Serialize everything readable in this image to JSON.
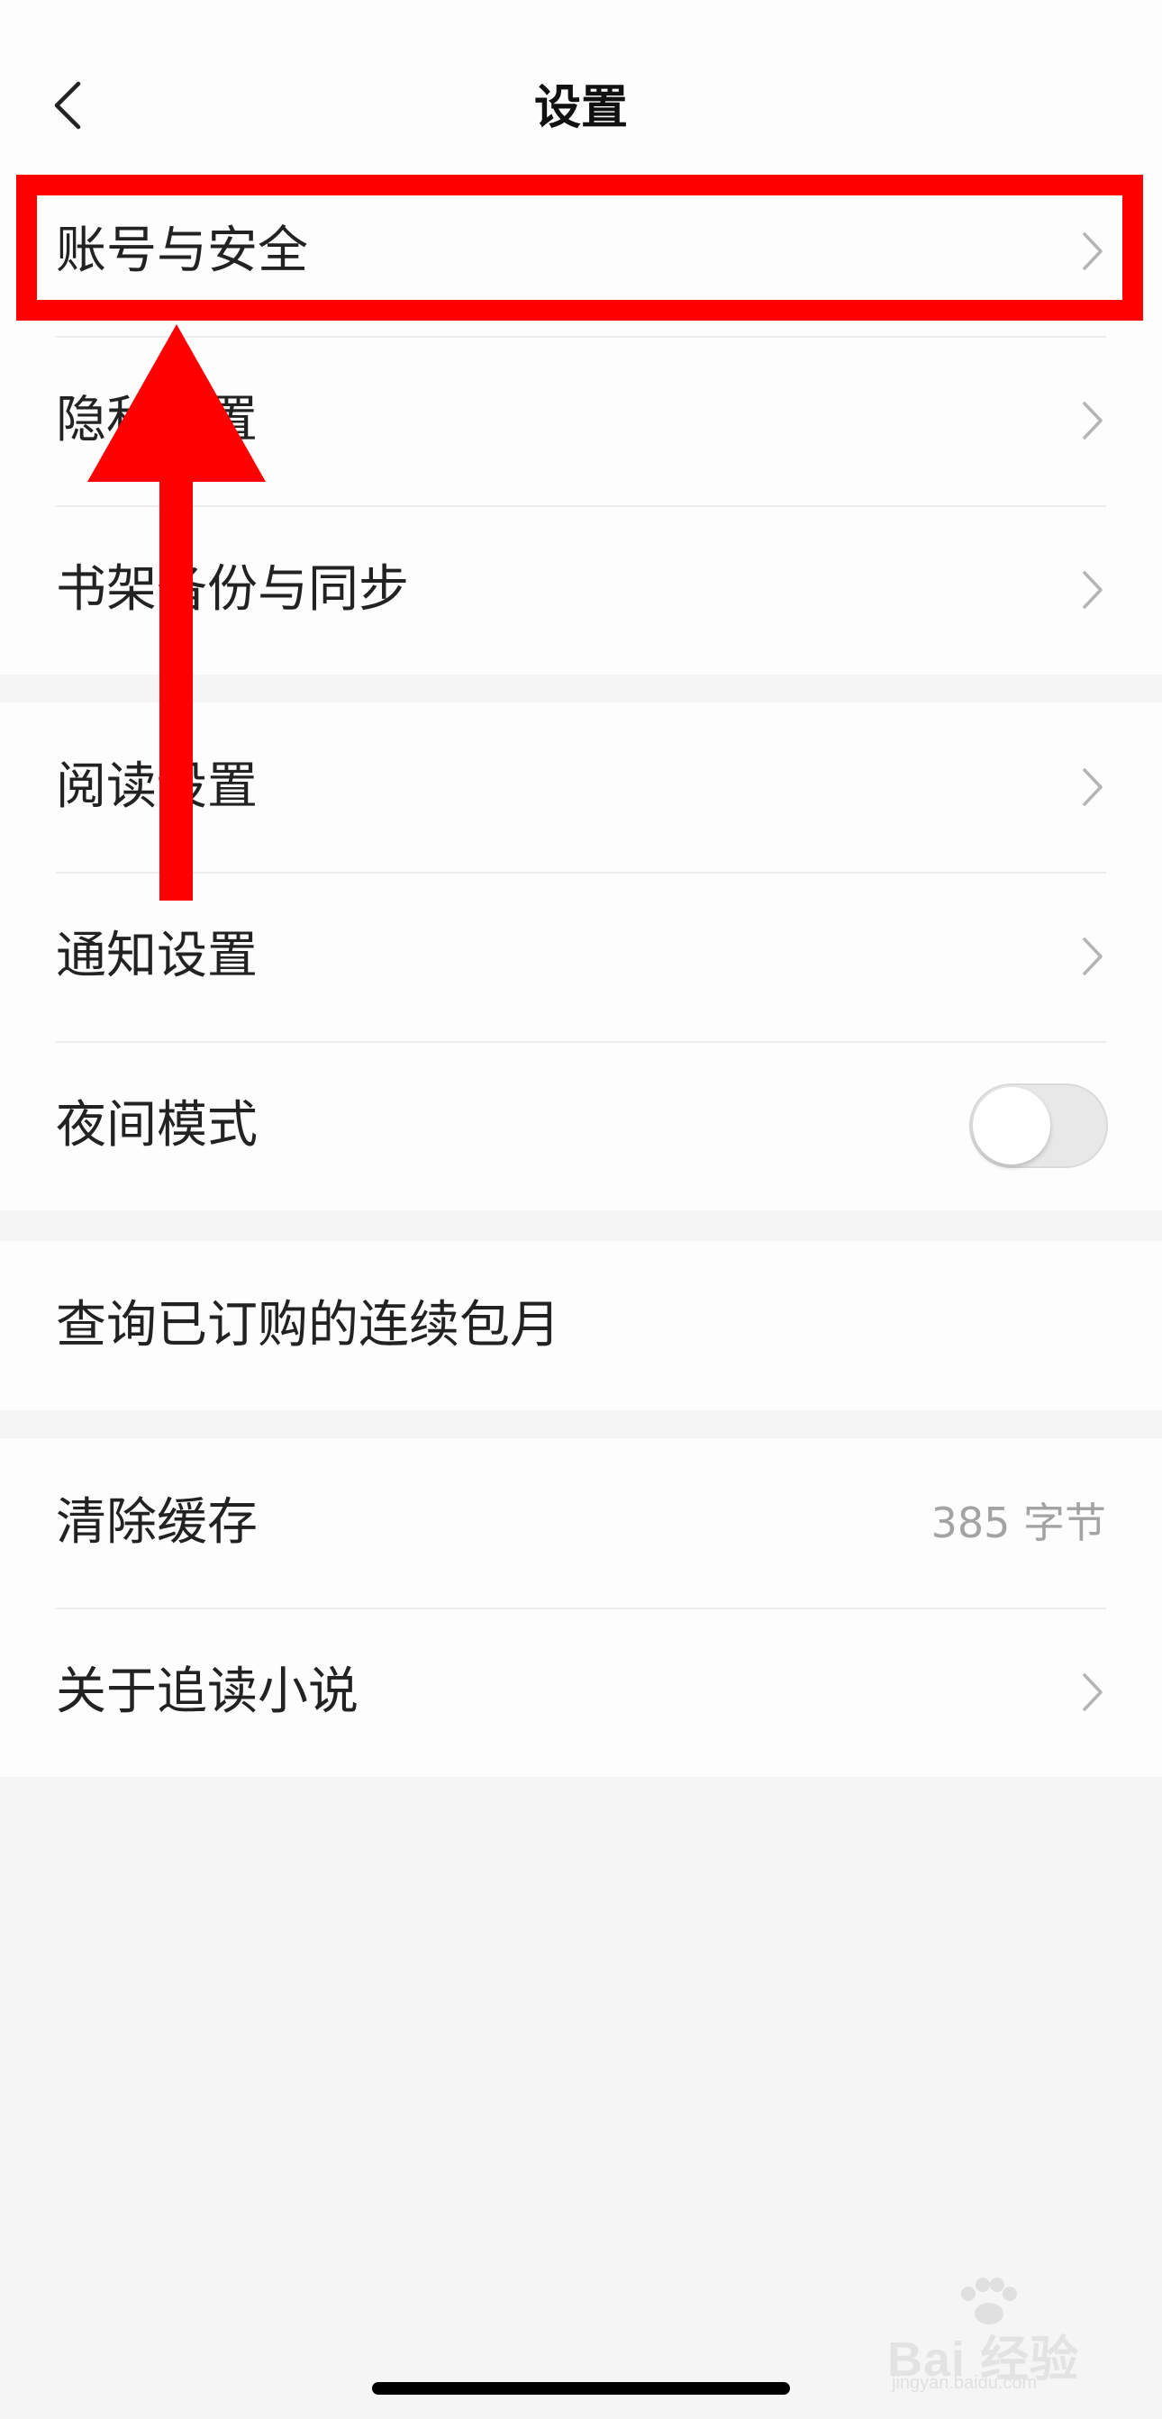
{
  "header": {
    "title": "设置"
  },
  "groups": [
    {
      "rows": [
        {
          "label": "账号与安全",
          "accessory": "chevron"
        },
        {
          "label": "隐私设置",
          "accessory": "chevron"
        },
        {
          "label": "书架备份与同步",
          "accessory": "chevron"
        }
      ]
    },
    {
      "rows": [
        {
          "label": "阅读设置",
          "accessory": "chevron"
        },
        {
          "label": "通知设置",
          "accessory": "chevron"
        },
        {
          "label": "夜间模式",
          "accessory": "toggle",
          "toggle_on": false
        }
      ]
    },
    {
      "rows": [
        {
          "label": "查询已订购的连续包月",
          "accessory": "none"
        }
      ]
    },
    {
      "rows": [
        {
          "label": "清除缓存",
          "accessory": "value",
          "value": "385 字节"
        },
        {
          "label": "关于追读小说",
          "accessory": "chevron"
        }
      ]
    }
  ],
  "annotation": {
    "highlight_color": "#ff0000",
    "arrow_color": "#ff0000"
  },
  "icons": {
    "back": "back-chevron-icon",
    "row": "chevron-right-icon"
  },
  "watermark": {
    "brand": "Bai 经验",
    "sub": "jingyan.baidu.com"
  }
}
